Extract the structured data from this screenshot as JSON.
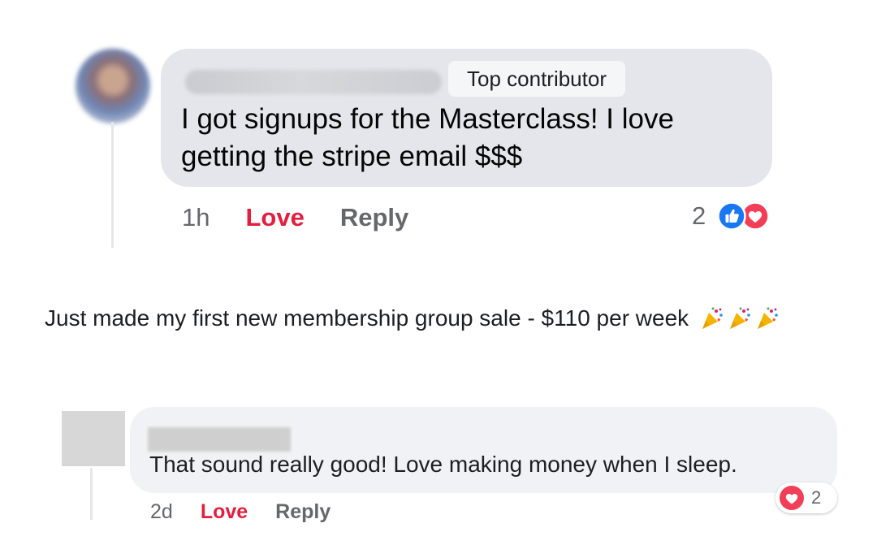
{
  "comment1": {
    "badge": "Top contributor",
    "text": "I got signups for the Masterclass! I love getting the stripe email $$$",
    "time": "1h",
    "love_label": "Love",
    "reply_label": "Reply",
    "reaction_count": "2",
    "reaction_icons": [
      "like-icon",
      "heart-icon"
    ]
  },
  "post": {
    "text": "Just made my first new membership group sale - $110 per week",
    "emoji": [
      "party-popper-icon",
      "party-popper-icon",
      "party-popper-icon"
    ]
  },
  "comment2": {
    "text": "That sound really good! Love making money when I sleep.",
    "time": "2d",
    "love_label": "Love",
    "reply_label": "Reply",
    "reaction_count": "2",
    "reaction_icons": [
      "heart-icon"
    ]
  },
  "colors": {
    "love": "#e41e3f",
    "like_blue": "#1877f2",
    "bubble_gray": "#e4e6eb",
    "muted_text": "#65676b"
  }
}
